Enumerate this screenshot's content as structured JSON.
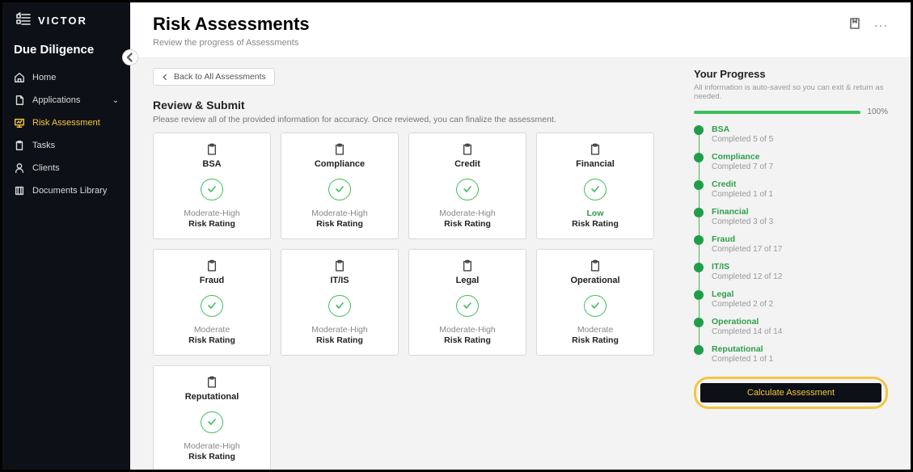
{
  "brand": {
    "name": "VICTOR"
  },
  "module": "Due Diligence",
  "nav": {
    "home": "Home",
    "applications": "Applications",
    "risk": "Risk Assessment",
    "tasks": "Tasks",
    "clients": "Clients",
    "docs": "Documents Library"
  },
  "header": {
    "title": "Risk Assessments",
    "subtitle": "Review the progress of Assessments",
    "more": "···"
  },
  "back_label": "Back to All Assessments",
  "review": {
    "title": "Review & Submit",
    "subtitle": "Please review all of the provided information for accuracy. Once reviewed, you can finalize the assessment."
  },
  "rating_label": "Risk Rating",
  "cards": [
    {
      "name": "BSA",
      "rating": "Moderate-High",
      "low": false
    },
    {
      "name": "Compliance",
      "rating": "Moderate-High",
      "low": false
    },
    {
      "name": "Credit",
      "rating": "Moderate-High",
      "low": false
    },
    {
      "name": "Financial",
      "rating": "Low",
      "low": true
    },
    {
      "name": "Fraud",
      "rating": "Moderate",
      "low": false
    },
    {
      "name": "IT/IS",
      "rating": "Moderate-High",
      "low": false
    },
    {
      "name": "Legal",
      "rating": "Moderate-High",
      "low": false
    },
    {
      "name": "Operational",
      "rating": "Moderate",
      "low": false
    },
    {
      "name": "Reputational",
      "rating": "Moderate-High",
      "low": false
    }
  ],
  "progress": {
    "title": "Your Progress",
    "subtitle": "All information is auto-saved so you can exit & return as needed.",
    "percent": "100%",
    "steps": [
      {
        "name": "BSA",
        "status": "Completed 5 of 5"
      },
      {
        "name": "Compliance",
        "status": "Completed 7 of 7"
      },
      {
        "name": "Credit",
        "status": "Completed 1 of 1"
      },
      {
        "name": "Financial",
        "status": "Completed 3 of 3"
      },
      {
        "name": "Fraud",
        "status": "Completed 17 of 17"
      },
      {
        "name": "IT/IS",
        "status": "Completed 12 of 12"
      },
      {
        "name": "Legal",
        "status": "Completed 2 of 2"
      },
      {
        "name": "Operational",
        "status": "Completed 14 of 14"
      },
      {
        "name": "Reputational",
        "status": "Completed 1 of 1"
      }
    ],
    "calc_label": "Calculate Assessment"
  }
}
